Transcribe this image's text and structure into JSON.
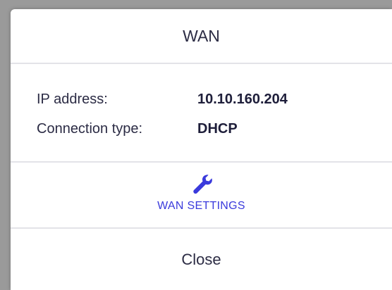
{
  "dialog": {
    "title": "WAN",
    "info": {
      "ip_label": "IP address:",
      "ip_value": "10.10.160.204",
      "conn_label": "Connection type:",
      "conn_value": "DHCP"
    },
    "settings": {
      "icon": "wrench-icon",
      "label": "WAN SETTINGS",
      "color": "#3a3adc"
    },
    "close_label": "Close"
  }
}
